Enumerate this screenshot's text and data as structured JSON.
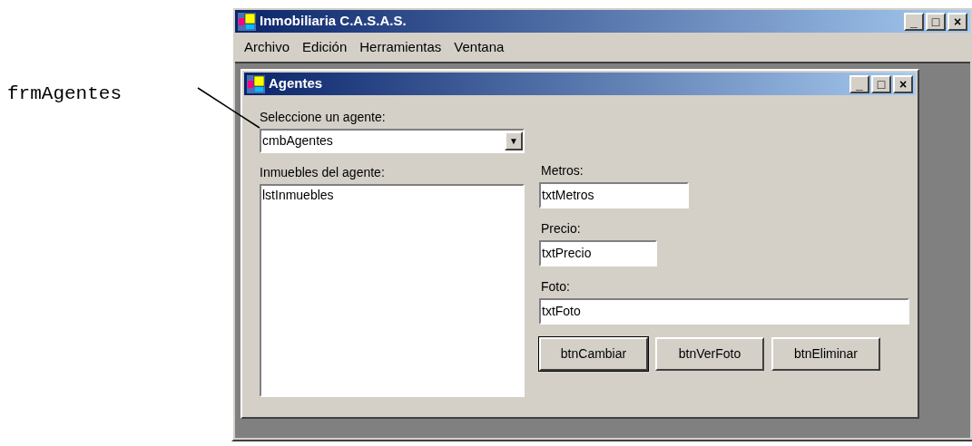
{
  "annotation": {
    "label": "frmAgentes"
  },
  "window": {
    "title": "Inmobiliaria C.A.S.A.S.",
    "controls": [
      "_",
      "□",
      "×"
    ]
  },
  "menu": [
    {
      "label": "Archivo"
    },
    {
      "label": "Edición"
    },
    {
      "label": "Herramientas"
    },
    {
      "label": "Ventana"
    }
  ],
  "child_window": {
    "title": "Agentes",
    "controls": [
      "_",
      "□",
      "×"
    ],
    "agent_label": "Seleccione un agente:",
    "agent_combo": {
      "value": "cmbAgentes",
      "arrow": "▼"
    },
    "properties_label": "Inmuebles del agente:",
    "properties_list": [
      "lstInmuebles"
    ],
    "fields": [
      {
        "label": "Metros:",
        "value": "txtMetros"
      },
      {
        "label": "Precio:",
        "value": "txtPrecio"
      },
      {
        "label": "Foto:",
        "value": "txtFoto"
      }
    ],
    "buttons": [
      {
        "label": "btnCambiar",
        "default": true
      },
      {
        "label": "btnVerFoto",
        "default": false
      },
      {
        "label": "btnEliminar",
        "default": false
      }
    ]
  }
}
